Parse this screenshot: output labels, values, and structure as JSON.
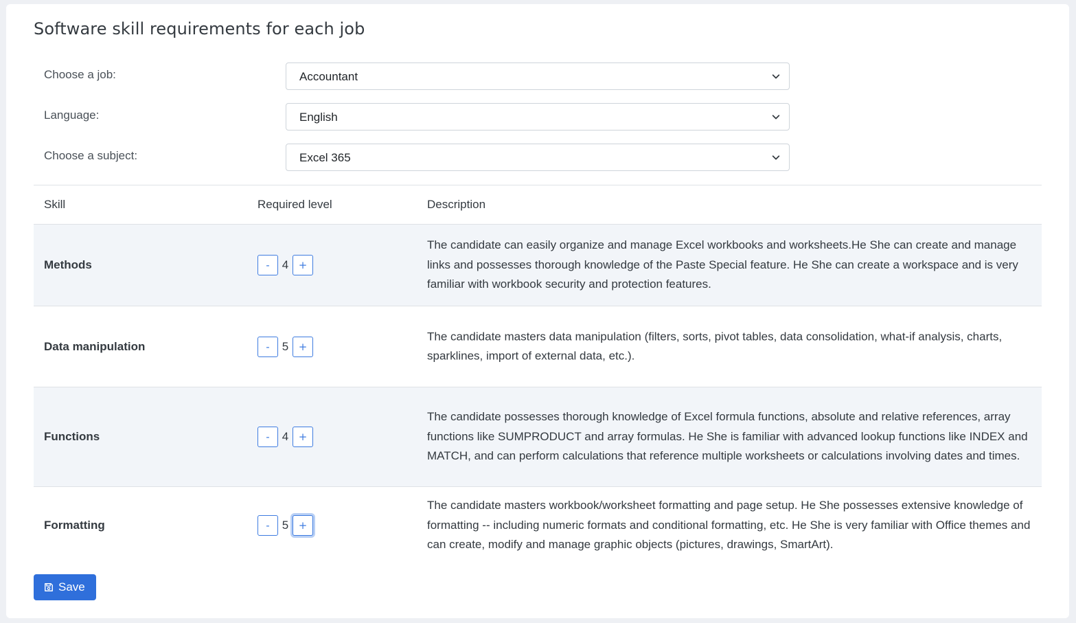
{
  "page": {
    "title": "Software skill requirements for each job"
  },
  "form": {
    "job": {
      "label": "Choose a job:",
      "value": "Accountant"
    },
    "language": {
      "label": "Language:",
      "value": "English"
    },
    "subject": {
      "label": "Choose a subject:",
      "value": "Excel 365"
    }
  },
  "table": {
    "headers": {
      "skill": "Skill",
      "level": "Required level",
      "description": "Description"
    },
    "rows": [
      {
        "skill": "Methods",
        "level": "4",
        "description": "The candidate can easily organize and manage Excel workbooks and worksheets.He She can create and manage links and possesses thorough knowledge of the Paste Special feature. He She can create a workspace and is very familiar with workbook security and protection features."
      },
      {
        "skill": "Data manipulation",
        "level": "5",
        "description": "The candidate masters data manipulation (filters, sorts, pivot tables, data consolidation, what-if analysis, charts, sparklines, import of external data, etc.)."
      },
      {
        "skill": "Functions",
        "level": "4",
        "description": "The candidate possesses thorough knowledge of Excel formula functions, absolute and relative references, array functions like SUMPRODUCT and array formulas. He She is familiar with advanced lookup functions like INDEX and MATCH, and can perform calculations that reference multiple worksheets or calculations involving dates and times."
      },
      {
        "skill": "Formatting",
        "level": "5",
        "description": "The candidate masters workbook/worksheet formatting and page setup. He She possesses extensive knowledge of formatting -- including numeric formats and conditional formatting, etc. He She is very familiar with Office themes and can create, modify and manage graphic objects (pictures, drawings, SmartArt)."
      }
    ],
    "decrement_label": "-",
    "increment_label": "+"
  },
  "actions": {
    "save_label": "Save",
    "save_icon": "floppy-disk-icon"
  },
  "colors": {
    "primary": "#2f6fdb",
    "stripe": "#f2f5f9"
  }
}
